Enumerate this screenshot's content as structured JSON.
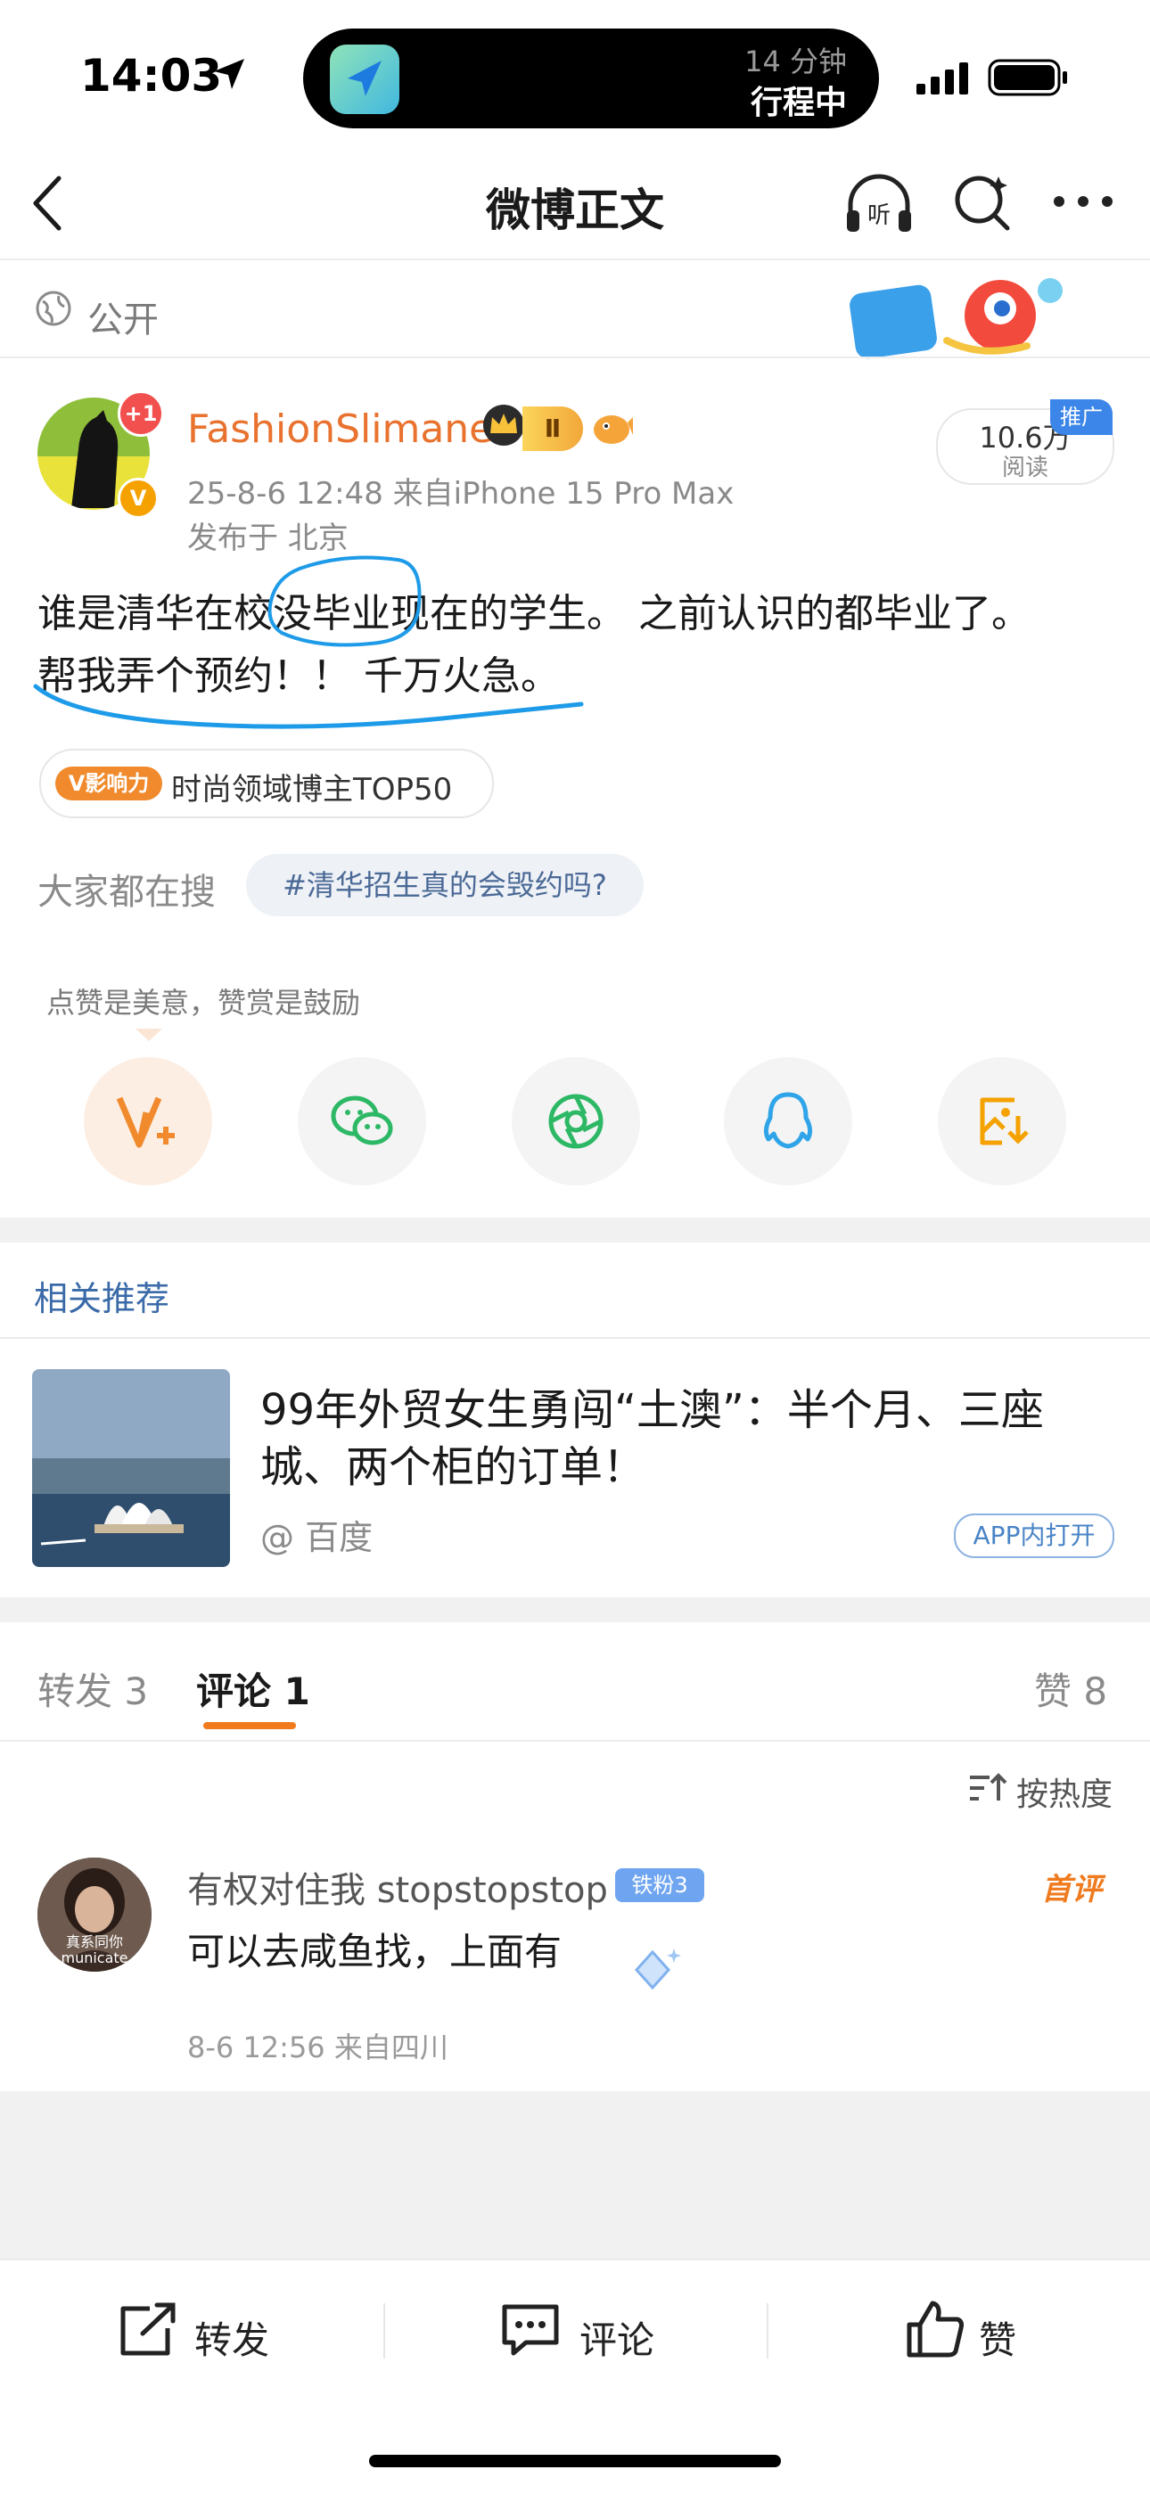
{
  "status_bar": {
    "time": "14:03"
  },
  "island": {
    "line1": "14 分钟",
    "line2": "行程中"
  },
  "nav": {
    "title": "微博正文"
  },
  "visibility": {
    "label": "公开"
  },
  "post": {
    "avatar_badge": "+1",
    "username": "FashionSlimane",
    "level": "Ⅱ",
    "meta": "25-8-6 12:48  来自iPhone 15 Pro Max",
    "location": "发布于 北京",
    "reads_count": "10.6万",
    "reads_label": "阅读",
    "promo_tag": "推广",
    "text_line1": "谁是清华在校没毕业现在的学生。 之前认识的都毕业了。",
    "text_line2": "帮我弄个预约！！ 千万火急。",
    "influence_tag": "V影响力",
    "influence_text": "时尚领域博主TOP50",
    "search_label": "大家都在搜",
    "hashtag": "#清华招生真的会毁约吗?",
    "tip": "点赞是美意，赞赏是鼓励"
  },
  "related": {
    "label": "相关推荐",
    "title": "99年外贸女生勇闯“土澳”：半个月、三座城、两个柜的订单！",
    "source": "@ 百度",
    "open_app": "APP内打开"
  },
  "tabs": [
    {
      "label": "转发 3"
    },
    {
      "label": "评论 1"
    },
    {
      "label": "赞 8"
    }
  ],
  "sort": {
    "label": "按热度"
  },
  "comment": {
    "avatar_text": "真系同你\nmunicate",
    "username": "有权对住我 stopstopstop",
    "fan_badge": "铁粉3",
    "first_badge": "首评",
    "text": "可以去咸鱼找，上面有",
    "meta": "8-6 12:56  来自四川"
  },
  "bottom_actions": [
    {
      "label": "转发",
      "icon": "share-icon"
    },
    {
      "label": "评论",
      "icon": "comment-icon"
    },
    {
      "label": "赞",
      "icon": "like-icon"
    }
  ],
  "colors": {
    "accent_orange": "#f07b1e",
    "link_blue": "#3a6aa8",
    "annotation_blue": "#1e9be8"
  }
}
